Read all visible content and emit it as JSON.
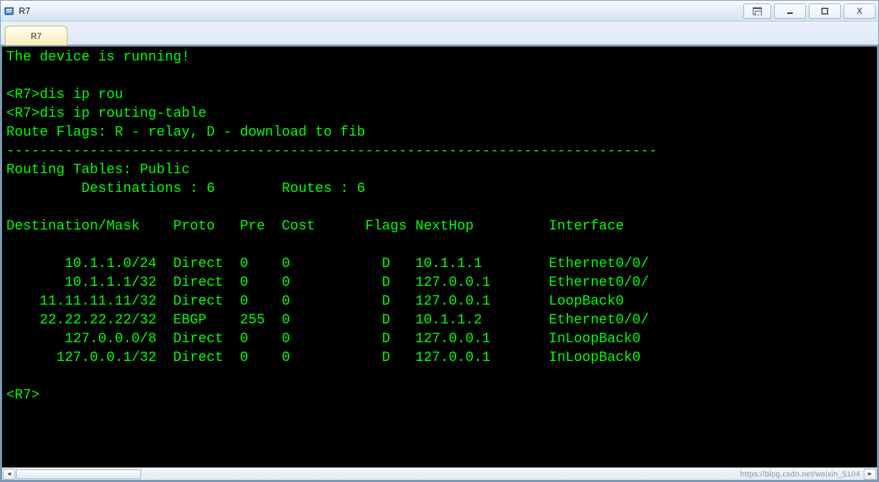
{
  "window": {
    "title": "R7"
  },
  "tabs": [
    {
      "label": "R7"
    }
  ],
  "terminal": {
    "banner": "The device is running!",
    "blank": "",
    "cmd1": "<R7>dis ip rou",
    "cmd2": "<R7>dis ip routing-table",
    "flags_legend": "Route Flags: R - relay, D - download to fib",
    "separator": "------------------------------------------------------------------------------",
    "table_title": "Routing Tables: Public",
    "summary": "         Destinations : 6        Routes : 6",
    "header": {
      "dest": "Destination/Mask",
      "proto": "Proto",
      "pre": "Pre",
      "cost": "Cost",
      "flags": "Flags",
      "nexthop": "NextHop",
      "iface": "Interface"
    },
    "rows": [
      {
        "dest": "10.1.1.0/24",
        "proto": "Direct",
        "pre": "0",
        "cost": "0",
        "flags": "D",
        "nexthop": "10.1.1.1",
        "iface": "Ethernet0/0/"
      },
      {
        "dest": "10.1.1.1/32",
        "proto": "Direct",
        "pre": "0",
        "cost": "0",
        "flags": "D",
        "nexthop": "127.0.0.1",
        "iface": "Ethernet0/0/"
      },
      {
        "dest": "11.11.11.11/32",
        "proto": "Direct",
        "pre": "0",
        "cost": "0",
        "flags": "D",
        "nexthop": "127.0.0.1",
        "iface": "LoopBack0"
      },
      {
        "dest": "22.22.22.22/32",
        "proto": "EBGP",
        "pre": "255",
        "cost": "0",
        "flags": "D",
        "nexthop": "10.1.1.2",
        "iface": "Ethernet0/0/"
      },
      {
        "dest": "127.0.0.0/8",
        "proto": "Direct",
        "pre": "0",
        "cost": "0",
        "flags": "D",
        "nexthop": "127.0.0.1",
        "iface": "InLoopBack0"
      },
      {
        "dest": "127.0.0.1/32",
        "proto": "Direct",
        "pre": "0",
        "cost": "0",
        "flags": "D",
        "nexthop": "127.0.0.1",
        "iface": "InLoopBack0"
      }
    ],
    "prompt": "<R7>"
  },
  "watermark": "https://blog.csdn.net/weixin_5104"
}
